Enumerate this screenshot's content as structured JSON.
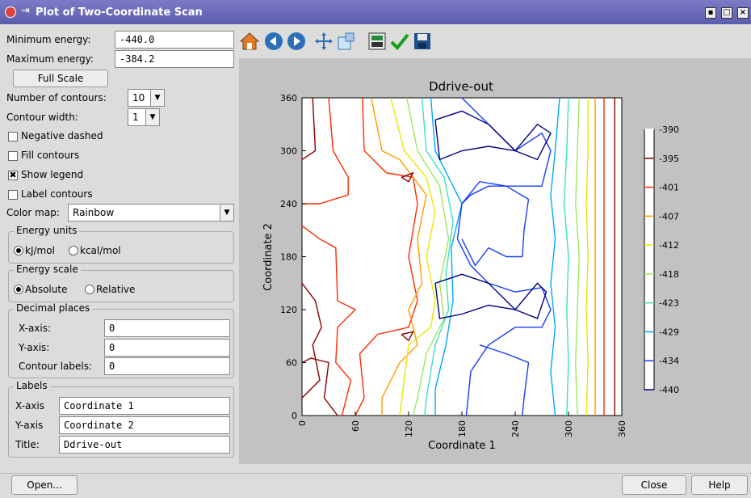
{
  "window": {
    "title": "Plot of Two-Coordinate Scan"
  },
  "controls": {
    "min_energy_label": "Minimum energy:",
    "min_energy_value": "-440.0",
    "max_energy_label": "Maximum energy:",
    "max_energy_value": "-384.2",
    "full_scale_label": "Full Scale",
    "num_contours_label": "Number of contours:",
    "num_contours_value": "10",
    "contour_width_label": "Contour width:",
    "contour_width_value": "1",
    "negative_dashed_label": "Negative dashed",
    "negative_dashed_checked": false,
    "fill_contours_label": "Fill contours",
    "fill_contours_checked": false,
    "show_legend_label": "Show legend",
    "show_legend_checked": true,
    "label_contours_label": "Label contours",
    "label_contours_checked": false,
    "color_map_label": "Color map:",
    "color_map_value": "Rainbow"
  },
  "energy_units": {
    "title": "Energy units",
    "option1": "kJ/mol",
    "option2": "kcal/mol",
    "selected": "kJ/mol"
  },
  "energy_scale": {
    "title": "Energy scale",
    "option1": "Absolute",
    "option2": "Relative",
    "selected": "Absolute"
  },
  "decimal_places": {
    "title": "Decimal places",
    "x_label": "X-axis:",
    "x_value": "0",
    "y_label": "Y-axis:",
    "y_value": "0",
    "contour_label": "Contour labels:",
    "contour_value": "0"
  },
  "labels": {
    "title": "Labels",
    "x_label": "X-axis",
    "x_value": "Coordinate 1",
    "y_label": "Y-axis",
    "y_value": "Coordinate 2",
    "title_label": "Title:",
    "title_value": "Ddrive-out"
  },
  "toolbar": {
    "icons": [
      "home-icon",
      "back-icon",
      "forward-icon",
      "pan-icon",
      "zoom-icon",
      "configure-subplots-icon",
      "accept-icon",
      "save-icon"
    ]
  },
  "buttons": {
    "open": "Open...",
    "close": "Close",
    "help": "Help"
  },
  "chart_data": {
    "type": "contour",
    "title": "Ddrive-out",
    "xlabel": "Coordinate 1",
    "ylabel": "Coordinate 2",
    "xlim": [
      0,
      360
    ],
    "ylim": [
      0,
      360
    ],
    "xticks": [
      0,
      60,
      120,
      180,
      240,
      300,
      360
    ],
    "yticks": [
      0,
      60,
      120,
      180,
      240,
      300,
      360
    ],
    "colorbar_levels": [
      -390,
      -395,
      -401,
      -407,
      -412,
      -418,
      -423,
      -429,
      -434,
      -440
    ],
    "colormap": "Rainbow",
    "level_colors": [
      "#ffffff",
      "#8b0000",
      "#ff2a00",
      "#ff9c00",
      "#e8e800",
      "#9be85c",
      "#40e0c0",
      "#00a8ff",
      "#1a3cff",
      "#000080"
    ]
  }
}
